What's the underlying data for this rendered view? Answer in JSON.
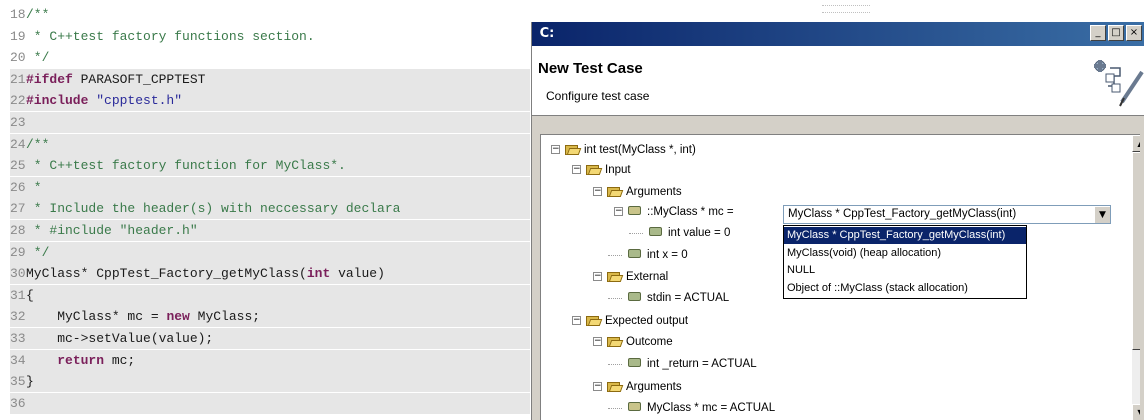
{
  "editor": {
    "lines": [
      {
        "num": "18",
        "parts": [
          {
            "t": "/**",
            "c": "comment"
          }
        ]
      },
      {
        "num": "19",
        "parts": [
          {
            "t": " * C++test factory functions section.",
            "c": "comment"
          }
        ]
      },
      {
        "num": "20",
        "parts": [
          {
            "t": " */",
            "c": "comment"
          }
        ]
      },
      {
        "num": "21",
        "parts": [
          {
            "t": "#ifdef",
            "c": "kw"
          },
          {
            "t": " PARASOFT_CPPTEST",
            "c": "code"
          }
        ]
      },
      {
        "num": "22",
        "parts": [
          {
            "t": "#include",
            "c": "kw"
          },
          {
            "t": " \"cpptest.h\"",
            "c": "str"
          }
        ]
      },
      {
        "num": "23",
        "parts": []
      },
      {
        "num": "24",
        "parts": [
          {
            "t": "/**",
            "c": "comment"
          }
        ]
      },
      {
        "num": "25",
        "parts": [
          {
            "t": " * C++test factory function for MyClass*.",
            "c": "comment"
          }
        ]
      },
      {
        "num": "26",
        "parts": [
          {
            "t": " *",
            "c": "comment"
          }
        ]
      },
      {
        "num": "27",
        "parts": [
          {
            "t": " * Include the header(s) with neccessary declara",
            "c": "comment"
          }
        ]
      },
      {
        "num": "28",
        "parts": [
          {
            "t": " * #include \"header.h\"",
            "c": "comment"
          }
        ]
      },
      {
        "num": "29",
        "parts": [
          {
            "t": " */",
            "c": "comment"
          }
        ]
      },
      {
        "num": "30",
        "parts": [
          {
            "t": "MyClass* CppTest_Factory_getMyClass(",
            "c": "code"
          },
          {
            "t": "int",
            "c": "kw"
          },
          {
            "t": " value)",
            "c": "code"
          }
        ]
      },
      {
        "num": "31",
        "parts": [
          {
            "t": "{",
            "c": "code"
          }
        ]
      },
      {
        "num": "32",
        "parts": [
          {
            "t": "    MyClass* mc = ",
            "c": "code"
          },
          {
            "t": "new",
            "c": "kw"
          },
          {
            "t": " MyClass;",
            "c": "code"
          }
        ]
      },
      {
        "num": "33",
        "parts": [
          {
            "t": "    mc->setValue(value);",
            "c": "code"
          }
        ]
      },
      {
        "num": "34",
        "parts": [
          {
            "t": "    ",
            "c": "code"
          },
          {
            "t": "return",
            "c": "kw"
          },
          {
            "t": " mc;",
            "c": "code"
          }
        ]
      },
      {
        "num": "35",
        "parts": [
          {
            "t": "}",
            "c": "code"
          }
        ]
      },
      {
        "num": "36",
        "parts": []
      }
    ]
  },
  "dialog": {
    "app_icon": "C:",
    "title": "New Test Case",
    "subtitle": "Configure test case",
    "window_buttons": [
      "_",
      "□",
      "×"
    ],
    "tree": [
      {
        "label": "int test(MyClass *, int)",
        "icon": "folder-icon",
        "exp": "minus"
      },
      {
        "label": "Input",
        "icon": "folder-icon",
        "exp": "minus"
      },
      {
        "label": "Arguments",
        "icon": "folder-icon",
        "exp": "minus"
      },
      {
        "label": "::MyClass * mc =",
        "icon": "pointer-icon",
        "exp": "minus"
      },
      {
        "label": "int value = 0",
        "icon": "leaf-icon",
        "exp": ""
      },
      {
        "label": "int x = 0",
        "icon": "leaf-icon",
        "exp": ""
      },
      {
        "label": "External",
        "icon": "folder-icon",
        "exp": "minus"
      },
      {
        "label": "stdin = ACTUAL",
        "icon": "leaf-icon",
        "exp": ""
      },
      {
        "label": "Expected output",
        "icon": "folder-icon",
        "exp": "minus"
      },
      {
        "label": "Outcome",
        "icon": "folder-icon",
        "exp": "minus"
      },
      {
        "label": "int _return = ACTUAL",
        "icon": "leaf-icon",
        "exp": ""
      },
      {
        "label": "Arguments",
        "icon": "folder-icon",
        "exp": "minus"
      },
      {
        "label": "MyClass * mc = ACTUAL",
        "icon": "pointer-icon",
        "exp": ""
      }
    ],
    "combo": {
      "value": "MyClass * CppTest_Factory_getMyClass(int)",
      "options": [
        "MyClass * CppTest_Factory_getMyClass(int)",
        "MyClass(void) (heap allocation)",
        "NULL",
        "Object of ::MyClass (stack allocation)"
      ],
      "selected_index": 0
    },
    "colors": {
      "titlebar": "#0a246a",
      "selection": "#0a246a",
      "folder": "#f3d874"
    }
  }
}
